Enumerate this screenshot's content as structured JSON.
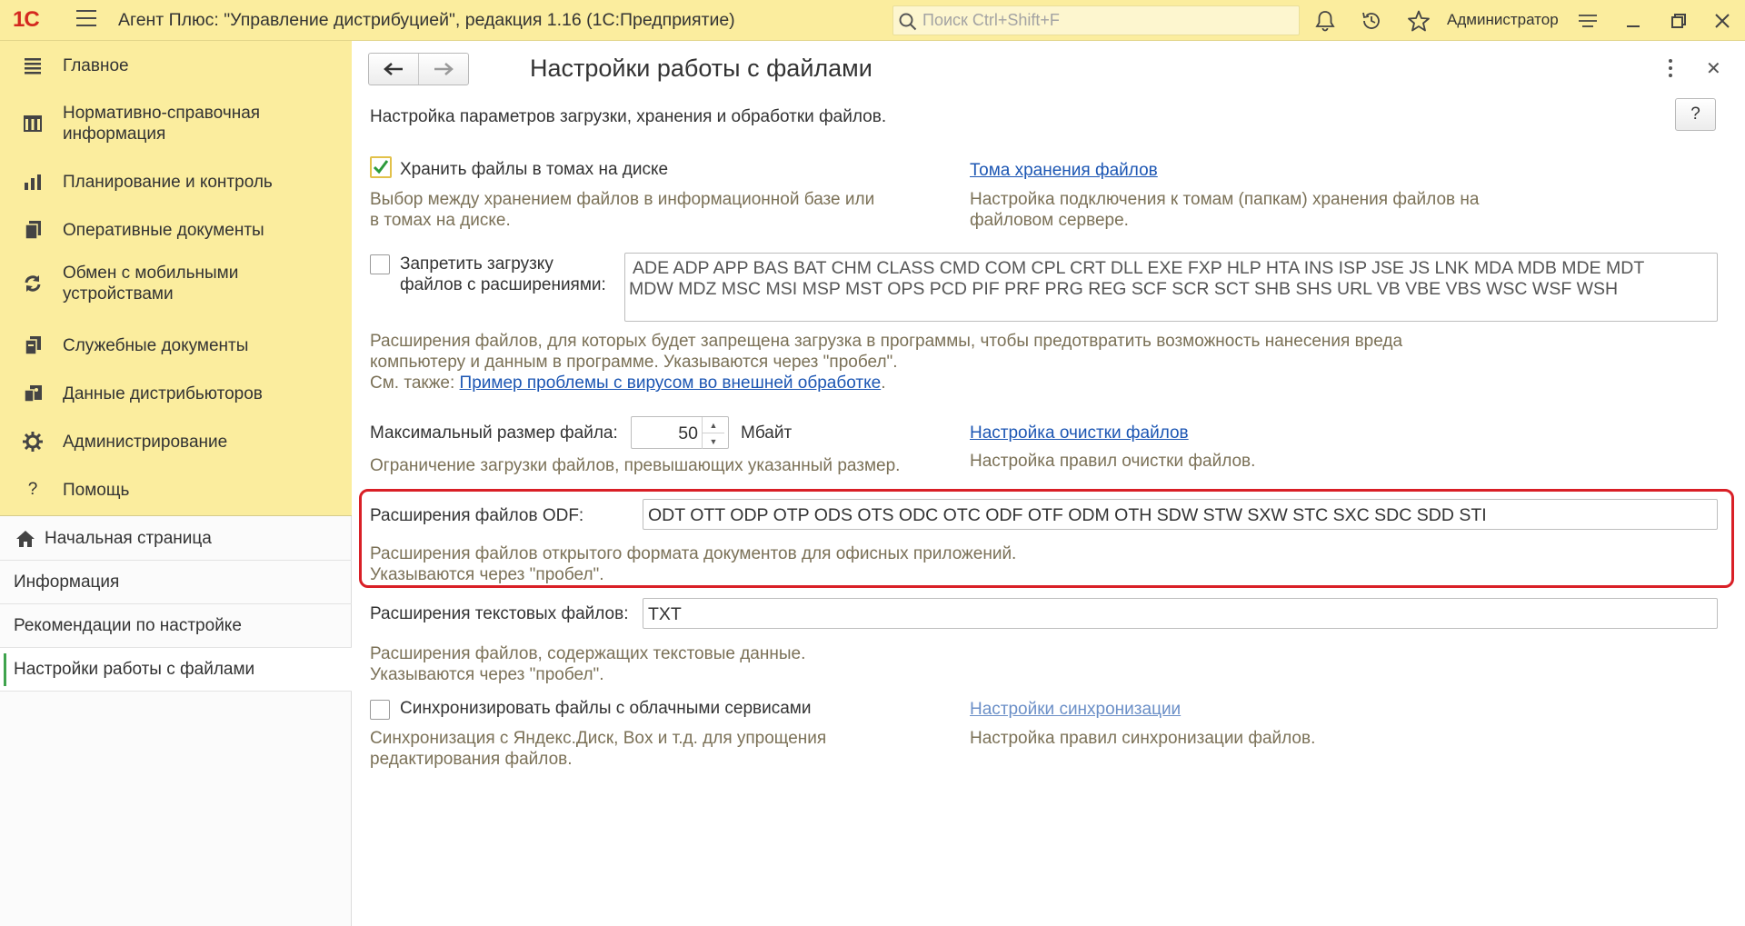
{
  "app": {
    "title": "Агент Плюс: \"Управление дистрибуцией\", редакция 1.16  (1С:Предприятие)",
    "logo_text": "1С",
    "search_placeholder": "Поиск Ctrl+Shift+F",
    "user": "Администратор"
  },
  "sidebar": {
    "sections": [
      {
        "label": "Главное",
        "icon": "menu-lines-icon"
      },
      {
        "label": "Нормативно-справочная информация",
        "icon": "catalog-icon"
      },
      {
        "label": "Планирование и контроль",
        "icon": "bar-chart-icon"
      },
      {
        "label": "Оперативные документы",
        "icon": "documents-icon"
      },
      {
        "label": "Обмен с мобильными устройствами",
        "icon": "sync-icon"
      },
      {
        "label": "Служебные документы",
        "icon": "service-docs-icon"
      },
      {
        "label": "Данные дистрибьюторов",
        "icon": "distributor-data-icon"
      },
      {
        "label": "Администрирование",
        "icon": "gear-icon"
      },
      {
        "label": "Помощь",
        "icon": "question-icon"
      }
    ],
    "nav": [
      {
        "label": "Начальная страница"
      },
      {
        "label": "Информация"
      },
      {
        "label": "Рекомендации по настройке"
      },
      {
        "label": "Настройки работы с файлами"
      }
    ]
  },
  "form": {
    "title": "Настройки работы с файлами",
    "subtitle": "Настройка параметров загрузки, хранения и обработки файлов.",
    "help_label": "?",
    "store_volumes": {
      "label": "Хранить файлы в томах на диске",
      "checked": true,
      "hint_line1": "Выбор между хранением файлов в информационной базе или",
      "hint_line2": "в томах на диске.",
      "link": "Тома хранения файлов",
      "link_hint_line1": "Настройка подключения к томам (папкам) хранения файлов на",
      "link_hint_line2": "файловом сервере."
    },
    "forbid_ext": {
      "label_line1": "Запретить загрузку",
      "label_line2": "файлов с расширениями:",
      "checked": false,
      "value_line1": "ADE ADP APP BAS BAT CHM CLASS CMD COM CPL CRT DLL EXE FXP HLP HTA INS ISP JSE JS LNK MDA MDB MDE MDT",
      "value_line2": "MDW MDZ MSC MSI MSP MST OPS PCD PIF PRF PRG REG SCF SCR SCT SHB SHS URL VB VBE VBS WSC WSF WSH",
      "hint_line1": "Расширения файлов, для которых будет запрещена загрузка в  программы, чтобы предотвратить возможность нанесения вреда",
      "hint_line2": "компьютеру и  данным в программе. Указываются через \"пробел\".",
      "see_also": "См. также:",
      "see_also_link": "Пример проблемы с вирусом во внешней  обработке",
      "see_also_end": "."
    },
    "max_size": {
      "label": "Максимальный размер файла:",
      "value": "50",
      "unit": "Мбайт",
      "hint": "Ограничение загрузки файлов, превышающих указанный размер.",
      "link": "Настройка очистки файлов",
      "link_hint": "Настройка правил очистки файлов."
    },
    "odf": {
      "label": "Расширения файлов ODF:",
      "value": "ODT OTT ODP OTP ODS OTS ODC OTC ODF OTF ODM OTH SDW STW SXW STC SXC SDC SDD STI",
      "hint_line1": "Расширения файлов открытого формата документов для офисных приложений.",
      "hint_line2": "Указываются через \"пробел\"."
    },
    "text_ext": {
      "label": "Расширения текстовых файлов:",
      "value": "TXT",
      "hint_line1": "Расширения файлов, содержащих текстовые данные.",
      "hint_line2": "Указываются через \"пробел\"."
    },
    "cloud_sync": {
      "label": "Синхронизировать файлы с облачными сервисами",
      "checked": false,
      "hint_line1": "Синхронизация с Яндекс.Диск, Box и т.д. для упрощения",
      "hint_line2": "редактирования файлов.",
      "link": "Настройки синхронизации",
      "link_hint": "Настройка правил синхронизации файлов."
    }
  },
  "colors": {
    "titlebar_bg": "#fbed9e",
    "hint_text": "#7b7157",
    "link": "#1c56b3",
    "highlight_border": "#d91f26",
    "active_marker": "#3fa34d"
  }
}
